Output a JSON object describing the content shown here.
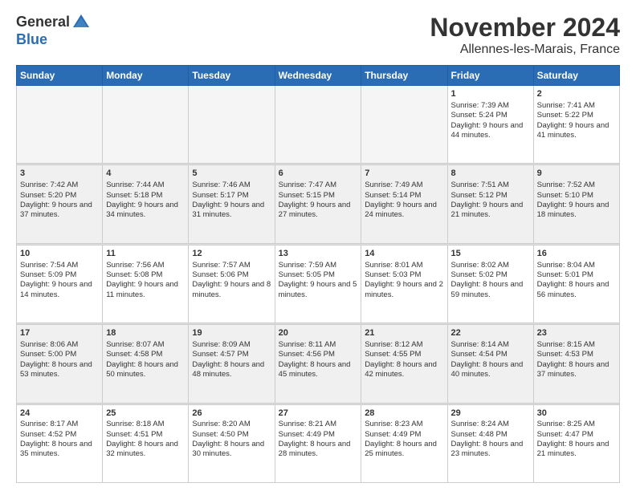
{
  "logo": {
    "general": "General",
    "blue": "Blue"
  },
  "header": {
    "month": "November 2024",
    "location": "Allennes-les-Marais, France"
  },
  "weekdays": [
    "Sunday",
    "Monday",
    "Tuesday",
    "Wednesday",
    "Thursday",
    "Friday",
    "Saturday"
  ],
  "weeks": [
    [
      {
        "day": "",
        "info": ""
      },
      {
        "day": "",
        "info": ""
      },
      {
        "day": "",
        "info": ""
      },
      {
        "day": "",
        "info": ""
      },
      {
        "day": "",
        "info": ""
      },
      {
        "day": "1",
        "info": "Sunrise: 7:39 AM\nSunset: 5:24 PM\nDaylight: 9 hours and 44 minutes."
      },
      {
        "day": "2",
        "info": "Sunrise: 7:41 AM\nSunset: 5:22 PM\nDaylight: 9 hours and 41 minutes."
      }
    ],
    [
      {
        "day": "3",
        "info": "Sunrise: 7:42 AM\nSunset: 5:20 PM\nDaylight: 9 hours and 37 minutes."
      },
      {
        "day": "4",
        "info": "Sunrise: 7:44 AM\nSunset: 5:18 PM\nDaylight: 9 hours and 34 minutes."
      },
      {
        "day": "5",
        "info": "Sunrise: 7:46 AM\nSunset: 5:17 PM\nDaylight: 9 hours and 31 minutes."
      },
      {
        "day": "6",
        "info": "Sunrise: 7:47 AM\nSunset: 5:15 PM\nDaylight: 9 hours and 27 minutes."
      },
      {
        "day": "7",
        "info": "Sunrise: 7:49 AM\nSunset: 5:14 PM\nDaylight: 9 hours and 24 minutes."
      },
      {
        "day": "8",
        "info": "Sunrise: 7:51 AM\nSunset: 5:12 PM\nDaylight: 9 hours and 21 minutes."
      },
      {
        "day": "9",
        "info": "Sunrise: 7:52 AM\nSunset: 5:10 PM\nDaylight: 9 hours and 18 minutes."
      }
    ],
    [
      {
        "day": "10",
        "info": "Sunrise: 7:54 AM\nSunset: 5:09 PM\nDaylight: 9 hours and 14 minutes."
      },
      {
        "day": "11",
        "info": "Sunrise: 7:56 AM\nSunset: 5:08 PM\nDaylight: 9 hours and 11 minutes."
      },
      {
        "day": "12",
        "info": "Sunrise: 7:57 AM\nSunset: 5:06 PM\nDaylight: 9 hours and 8 minutes."
      },
      {
        "day": "13",
        "info": "Sunrise: 7:59 AM\nSunset: 5:05 PM\nDaylight: 9 hours and 5 minutes."
      },
      {
        "day": "14",
        "info": "Sunrise: 8:01 AM\nSunset: 5:03 PM\nDaylight: 9 hours and 2 minutes."
      },
      {
        "day": "15",
        "info": "Sunrise: 8:02 AM\nSunset: 5:02 PM\nDaylight: 8 hours and 59 minutes."
      },
      {
        "day": "16",
        "info": "Sunrise: 8:04 AM\nSunset: 5:01 PM\nDaylight: 8 hours and 56 minutes."
      }
    ],
    [
      {
        "day": "17",
        "info": "Sunrise: 8:06 AM\nSunset: 5:00 PM\nDaylight: 8 hours and 53 minutes."
      },
      {
        "day": "18",
        "info": "Sunrise: 8:07 AM\nSunset: 4:58 PM\nDaylight: 8 hours and 50 minutes."
      },
      {
        "day": "19",
        "info": "Sunrise: 8:09 AM\nSunset: 4:57 PM\nDaylight: 8 hours and 48 minutes."
      },
      {
        "day": "20",
        "info": "Sunrise: 8:11 AM\nSunset: 4:56 PM\nDaylight: 8 hours and 45 minutes."
      },
      {
        "day": "21",
        "info": "Sunrise: 8:12 AM\nSunset: 4:55 PM\nDaylight: 8 hours and 42 minutes."
      },
      {
        "day": "22",
        "info": "Sunrise: 8:14 AM\nSunset: 4:54 PM\nDaylight: 8 hours and 40 minutes."
      },
      {
        "day": "23",
        "info": "Sunrise: 8:15 AM\nSunset: 4:53 PM\nDaylight: 8 hours and 37 minutes."
      }
    ],
    [
      {
        "day": "24",
        "info": "Sunrise: 8:17 AM\nSunset: 4:52 PM\nDaylight: 8 hours and 35 minutes."
      },
      {
        "day": "25",
        "info": "Sunrise: 8:18 AM\nSunset: 4:51 PM\nDaylight: 8 hours and 32 minutes."
      },
      {
        "day": "26",
        "info": "Sunrise: 8:20 AM\nSunset: 4:50 PM\nDaylight: 8 hours and 30 minutes."
      },
      {
        "day": "27",
        "info": "Sunrise: 8:21 AM\nSunset: 4:49 PM\nDaylight: 8 hours and 28 minutes."
      },
      {
        "day": "28",
        "info": "Sunrise: 8:23 AM\nSunset: 4:49 PM\nDaylight: 8 hours and 25 minutes."
      },
      {
        "day": "29",
        "info": "Sunrise: 8:24 AM\nSunset: 4:48 PM\nDaylight: 8 hours and 23 minutes."
      },
      {
        "day": "30",
        "info": "Sunrise: 8:25 AM\nSunset: 4:47 PM\nDaylight: 8 hours and 21 minutes."
      }
    ]
  ]
}
